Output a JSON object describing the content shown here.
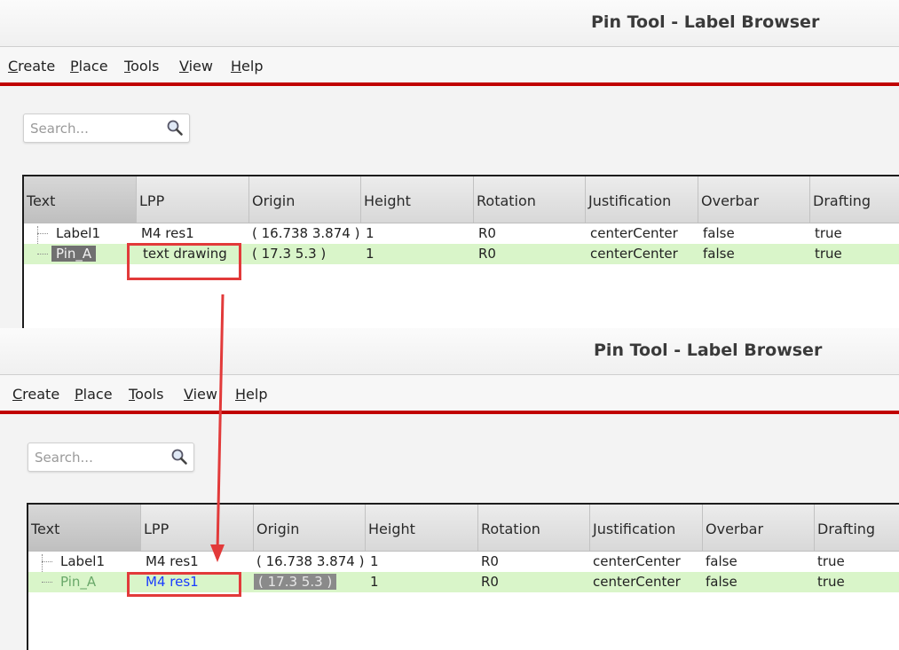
{
  "window_top": {
    "title": "Pin Tool - Label Browser",
    "menu": [
      "Create",
      "Place",
      "Tools",
      "View",
      "Help"
    ],
    "search": {
      "placeholder": "Search..."
    },
    "columns": [
      "Text",
      "LPP",
      "Origin",
      "Height",
      "Rotation",
      "Justification",
      "Overbar",
      "Drafting"
    ],
    "rows": [
      {
        "text": "Label1",
        "lpp": "M4 res1",
        "origin": "( 16.738 3.874 )",
        "height": "1",
        "rotation": "R0",
        "justification": "centerCenter",
        "overbar": "false",
        "drafting": "true"
      },
      {
        "text": "Pin_A",
        "lpp": "text drawing",
        "origin": "( 17.3 5.3 )",
        "height": "1",
        "rotation": "R0",
        "justification": "centerCenter",
        "overbar": "false",
        "drafting": "true"
      }
    ]
  },
  "window_bottom": {
    "title": "Pin Tool - Label Browser",
    "menu": [
      "Create",
      "Place",
      "Tools",
      "View",
      "Help"
    ],
    "search": {
      "placeholder": "Search..."
    },
    "columns": [
      "Text",
      "LPP",
      "Origin",
      "Height",
      "Rotation",
      "Justification",
      "Overbar",
      "Drafting"
    ],
    "rows": [
      {
        "text": "Label1",
        "lpp": "M4 res1",
        "origin": "( 16.738 3.874 )",
        "height": "1",
        "rotation": "R0",
        "justification": "centerCenter",
        "overbar": "false",
        "drafting": "true"
      },
      {
        "text": "Pin_A",
        "lpp": "M4 res1",
        "origin": "( 17.3 5.3 )",
        "height": "1",
        "rotation": "R0",
        "justification": "centerCenter",
        "overbar": "false",
        "drafting": "true"
      }
    ]
  },
  "colors": {
    "accent_bar": "#c00000",
    "callout": "#e23a3a",
    "row_highlight": "#d9f5c9",
    "edited_text": "#1a3cff"
  },
  "icons": {
    "search": "search-icon"
  }
}
